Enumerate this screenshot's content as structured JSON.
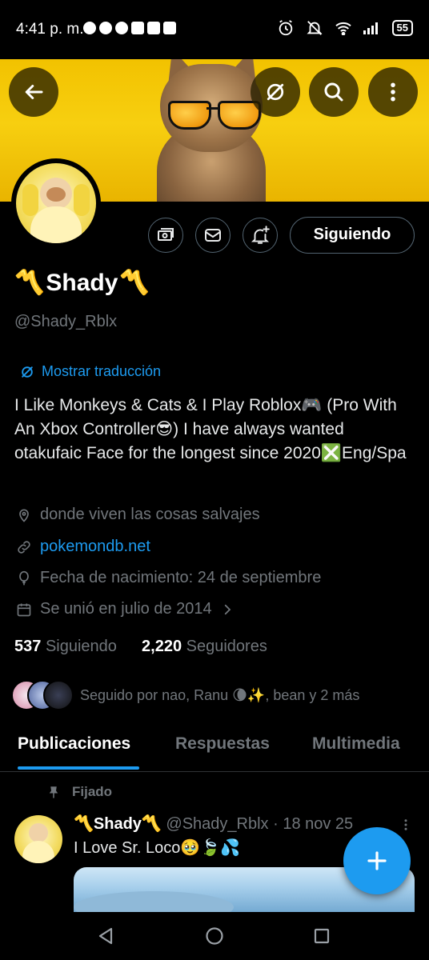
{
  "status_bar": {
    "time": "4:41 p. m.",
    "battery": "55"
  },
  "profile": {
    "name": "Shady",
    "name_emoji": "〽️",
    "handle": "@Shady_Rblx",
    "translate_label": "Mostrar traducción",
    "bio": "I Like Monkeys & Cats & I Play Roblox🎮 (Pro With An Xbox Controller😎) I have always wanted otakufaic  Face for the longest since 2020❎Eng/Spa",
    "location": "donde viven las cosas salvajes",
    "website": "pokemondb.net",
    "birthday": "Fecha de nacimiento: 24 de septiembre",
    "joined": "Se unió en julio de 2014",
    "following_count": "537",
    "following_label": "Siguiendo",
    "followers_count": "2,220",
    "followers_label": "Seguidores",
    "followed_by": "Seguido por nao, Ranu 🌘✨, bean y 2 más",
    "follow_button": "Siguiendo"
  },
  "tabs": [
    {
      "label": "Publicaciones",
      "active": true
    },
    {
      "label": "Respuestas",
      "active": false
    },
    {
      "label": "Multimedia",
      "active": false
    }
  ],
  "pinned_post": {
    "pinned_label": "Fijado",
    "author_name": "〽️Shady〽️",
    "author_handle": "@Shady_Rblx",
    "date": "· 18 nov 25",
    "text": "I Love Sr. Loco🥹🍃💦"
  },
  "colors": {
    "accent": "#1d9bf0",
    "banner": "#f5c800",
    "muted": "#71767b"
  },
  "icons": [
    "back-arrow-icon",
    "translate-icon",
    "search-icon",
    "more-vertical-icon",
    "money-icon",
    "mail-icon",
    "bell-plus-icon",
    "location-icon",
    "link-icon",
    "balloon-icon",
    "calendar-icon",
    "chevron-right-icon",
    "pin-icon",
    "plus-icon"
  ]
}
